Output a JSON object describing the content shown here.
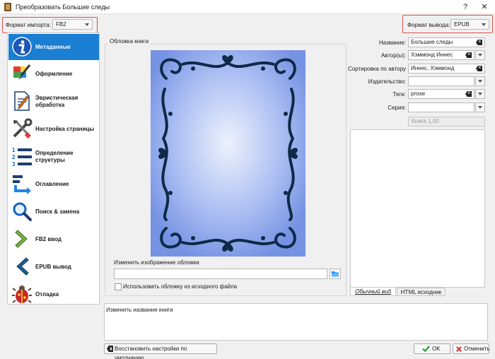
{
  "window": {
    "title": "Преобразовать Большие следы",
    "minimize": "—",
    "close": "✕"
  },
  "top": {
    "import_label": "Формат импорта:",
    "import_value": "FB2",
    "output_label": "Формат вывода:",
    "output_value": "EPUB"
  },
  "sidebar": {
    "items": [
      {
        "label": "Метаданные",
        "icon": "info-icon",
        "selected": true
      },
      {
        "label": "Оформление",
        "icon": "paintbrush-icon"
      },
      {
        "label": "Эвристическая обработка",
        "icon": "document-pencil-icon"
      },
      {
        "label": "Настройка страницы",
        "icon": "tools-icon"
      },
      {
        "label": "Определение структуры",
        "icon": "numbered-list-icon"
      },
      {
        "label": "Оглавление",
        "icon": "toc-icon"
      },
      {
        "label": "Поиск & замена",
        "icon": "magnifier-icon"
      },
      {
        "label": "FB2 ввод",
        "icon": "arrow-right-icon"
      },
      {
        "label": "EPUB вывод",
        "icon": "arrow-left-icon"
      },
      {
        "label": "Отладка",
        "icon": "bug-icon"
      }
    ]
  },
  "cover": {
    "caption": "Обложка книги",
    "change_label": "Изменить изображение обложки",
    "path_value": "",
    "use_source_label": "Использовать обложку из исходного файла"
  },
  "meta": {
    "title_label": "Название:",
    "title_value": "Большие следы",
    "authors_label": "Автор(ы):",
    "authors_value": "Хэммонд Иннес",
    "sort_label": "Сортировка по автору",
    "sort_value": "Иннес, Хэммонд",
    "publisher_label": "Издательство:",
    "publisher_value": "",
    "tags_label": "Теги:",
    "tags_value": "prose",
    "series_label": "Серия:",
    "series_value": "",
    "series_index": "Книга 1,00",
    "tab_normal": "Обычный вид",
    "tab_html": "HTML исходник"
  },
  "bottom": {
    "help_text": "Изменить название книги",
    "restore_label": "Восстановить настройки по умолчанию",
    "ok_label": "OK",
    "cancel_label": "Отменить"
  },
  "colors": {
    "selection": "#1a7ed3",
    "highlight_box": "#d9534f",
    "cover_bg": "#7f98e6",
    "cover_frame": "#0e2a47"
  }
}
